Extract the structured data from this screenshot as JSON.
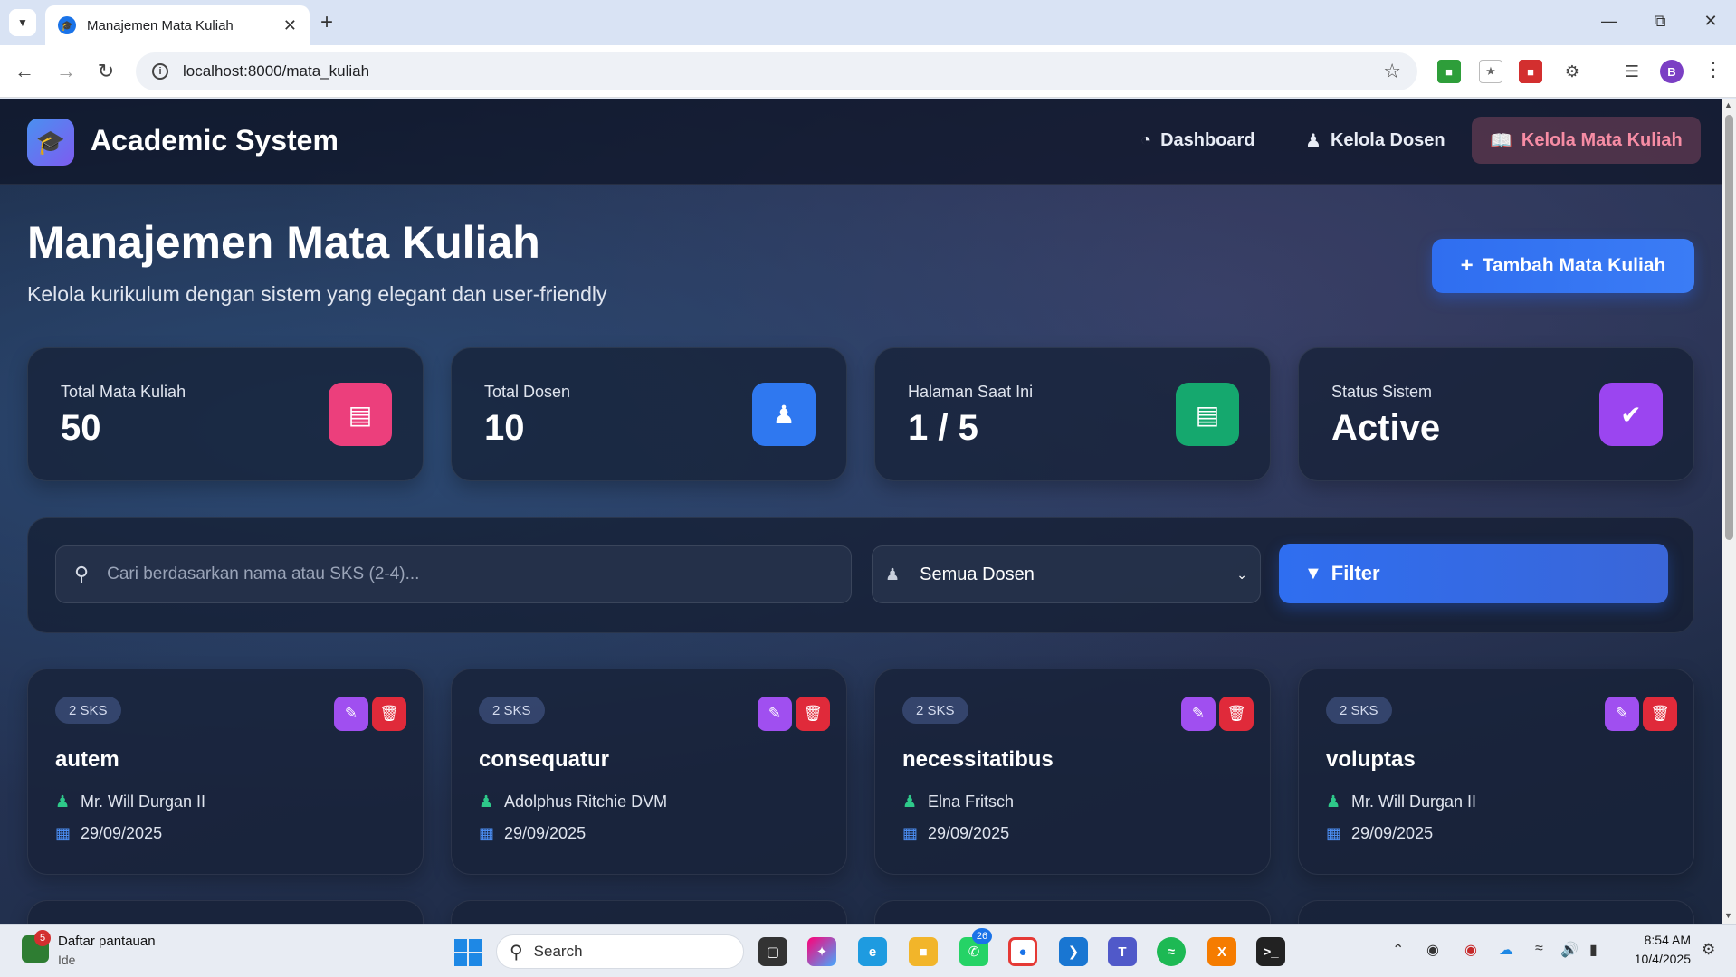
{
  "browser": {
    "tab_title": "Manajemen Mata Kuliah",
    "url": "localhost:8000/mata_kuliah",
    "profile_initial": "B"
  },
  "app": {
    "brand": "Academic System",
    "nav": [
      {
        "label": "Dashboard",
        "icon": "gauge-icon"
      },
      {
        "label": "Kelola Dosen",
        "icon": "users-icon"
      },
      {
        "label": "Kelola Mata Kuliah",
        "icon": "book-open-icon",
        "active": true
      }
    ]
  },
  "header": {
    "title": "Manajemen Mata Kuliah",
    "subtitle": "Kelola kurikulum dengan sistem yang elegant dan user-friendly",
    "add_button": "Tambah Mata Kuliah"
  },
  "stats": [
    {
      "label": "Total Mata Kuliah",
      "value": "50",
      "icon": "book-icon",
      "color": "#ec3f7c"
    },
    {
      "label": "Total Dosen",
      "value": "10",
      "icon": "users-icon",
      "color": "#2f78f0"
    },
    {
      "label": "Halaman Saat Ini",
      "value": "1 / 5",
      "icon": "file-icon",
      "color": "#15a86e"
    },
    {
      "label": "Status Sistem",
      "value": "Active",
      "icon": "check-circle-icon",
      "color": "#9b45f0"
    }
  ],
  "filters": {
    "search_placeholder": "Cari berdasarkan nama atau SKS (2-4)...",
    "search_value": "",
    "dosen_selected": "Semua Dosen",
    "filter_button": "Filter"
  },
  "courses": [
    {
      "sks": "2 SKS",
      "name": "autem",
      "lecturer": "Mr. Will Durgan II",
      "date": "29/09/2025"
    },
    {
      "sks": "2 SKS",
      "name": "consequatur",
      "lecturer": "Adolphus Ritchie DVM",
      "date": "29/09/2025"
    },
    {
      "sks": "2 SKS",
      "name": "necessitatibus",
      "lecturer": "Elna Fritsch",
      "date": "29/09/2025"
    },
    {
      "sks": "2 SKS",
      "name": "voluptas",
      "lecturer": "Mr. Will Durgan II",
      "date": "29/09/2025"
    }
  ],
  "taskbar": {
    "widget_title": "Daftar pantauan",
    "widget_sub": "Ide",
    "widget_badge": "5",
    "search_label": "Search",
    "whatsapp_badge": "26",
    "time": "8:54 AM",
    "date": "10/4/2025"
  }
}
